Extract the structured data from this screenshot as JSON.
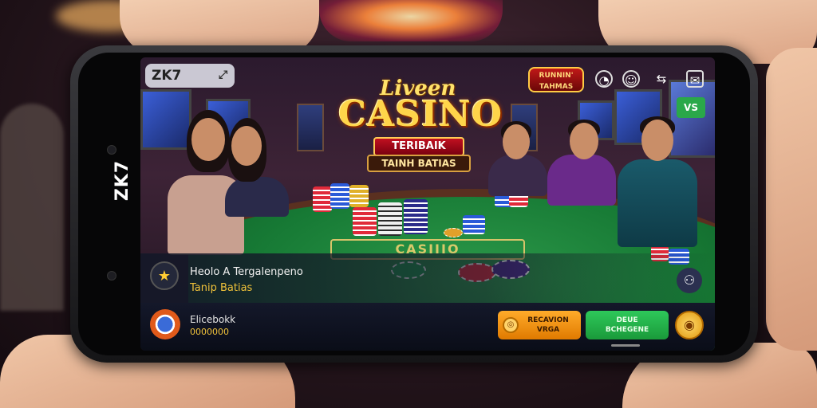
{
  "app": {
    "side_logo": "ZK7"
  },
  "header": {
    "search_label": "ZK7",
    "badge_text": "RUNNIN' TAHMAS",
    "icons": [
      "clock-icon",
      "chat-icon",
      "share-icon",
      "mail-icon"
    ],
    "mini_button": "VS"
  },
  "logo": {
    "live": "Liveen",
    "casino": "CASINO",
    "ribbon": "TERIBAIK",
    "sub": "TAINH BATIAS"
  },
  "table": {
    "felt_label": "CASIIIO"
  },
  "info": {
    "title": "Heolo A Tergalenpeno",
    "subtitle": "Tanip Batias"
  },
  "bottom": {
    "title": "Elicebokk",
    "subtitle": "0000000",
    "orange_button": "RECAVION\nVRGA",
    "green_button": "DEUE\nBCHEGENE"
  },
  "colors": {
    "felt": "#177a35",
    "gold": "#ffd54a",
    "orange": "#e07a00",
    "green": "#1a9a3a"
  }
}
